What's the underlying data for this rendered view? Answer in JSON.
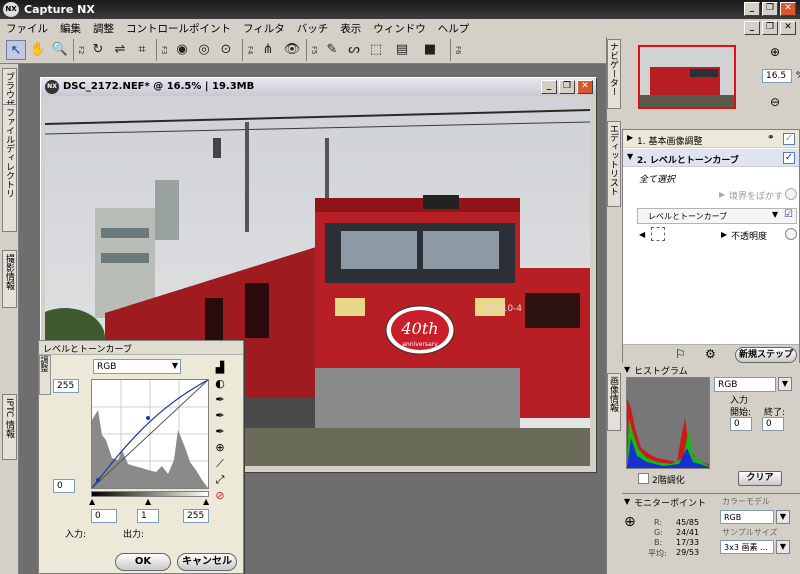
{
  "app": {
    "title": "Capture NX",
    "logo": "NX"
  },
  "menu": [
    "ファイル",
    "編集",
    "調整",
    "コントロールポイント",
    "フィルタ",
    "バッチ",
    "表示",
    "ウィンドウ",
    "ヘルプ"
  ],
  "toolbar": {
    "groups": [
      "F2",
      "F3",
      "F4",
      "F5",
      "F6"
    ]
  },
  "left_tabs": [
    "ブラウザー",
    "ファイルディレクトリ",
    "撮影情報",
    "IPTC 情報"
  ],
  "image_window": {
    "title": "DSC_2172.NEF* @ 16.5% | 19.3MB",
    "loco_number": "EF510-4",
    "badge_text": "40th",
    "badge_sub": "anniversary"
  },
  "levels": {
    "title": "レベルとトーンカーブ",
    "side_label": "調整",
    "channel": "RGB",
    "top_value": "255",
    "bottom_value": "0",
    "black": "0",
    "gamma": "1",
    "white": "255",
    "input_label": "入力:",
    "output_label": "出力:",
    "ok": "OK",
    "cancel": "キャンセル"
  },
  "navigator": {
    "tab": "ナビゲーター",
    "zoom": "16.5",
    "unit": "%"
  },
  "edit_list": {
    "tab": "エディットリスト",
    "step1": "1. 基本画像調整",
    "step2": "2. レベルとトーンカーブ",
    "select_all": "全て選択",
    "feather": "境界をぼかす",
    "step_name": "レベルとトーンカーブ",
    "opacity": "不透明度",
    "new_step": "新規ステップ"
  },
  "histogram": {
    "title": "ヒストグラム",
    "tab": "画像情報",
    "channel": "RGB",
    "input_label": "入力",
    "start_label": "開始:",
    "end_label": "終了:",
    "start": "0",
    "end": "0",
    "two_tone": "2階調化",
    "clear": "クリア"
  },
  "monitor": {
    "title": "モニターポイント",
    "color_model_label": "カラーモデル",
    "color_model": "RGB",
    "sample_size_label": "サンプルサイズ",
    "sample_size": "3x3 画素 ...",
    "r_label": "R:",
    "r": "45/85",
    "g_label": "G:",
    "g": "24/41",
    "b_label": "B:",
    "b": "17/33",
    "avg_label": "平均:",
    "avg": "29/53"
  },
  "colors": {
    "title_dark": "#1a1a1a",
    "loco_red": "#b81f24",
    "close_orange": "#d9572f",
    "accent_blue": "#1a3aa0"
  }
}
